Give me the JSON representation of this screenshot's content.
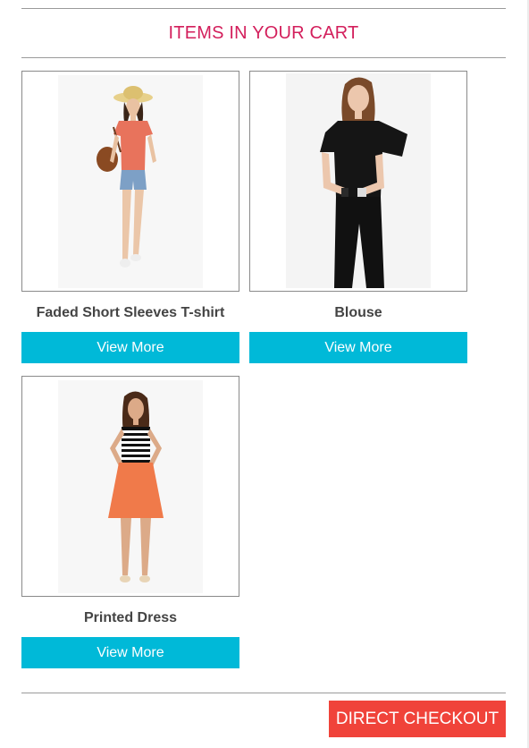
{
  "cart": {
    "title": "ITEMS IN YOUR CART",
    "items": [
      {
        "name": "Faded Short Sleeves T-shirt",
        "button_label": "View More"
      },
      {
        "name": "Blouse",
        "button_label": "View More"
      },
      {
        "name": "Printed Dress",
        "button_label": "View More"
      }
    ],
    "checkout_label": "DIRECT CHECKOUT"
  },
  "colors": {
    "title": "#d31f5c",
    "view_button": "#00b9d8",
    "checkout_button": "#f0433a",
    "product_name": "#444444"
  }
}
